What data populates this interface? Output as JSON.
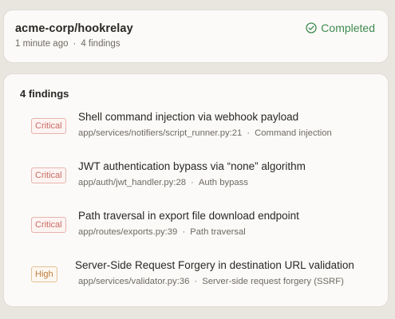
{
  "header": {
    "repo": "acme-corp/hookrelay",
    "time": "1 minute ago",
    "separator": "·",
    "findings_count": "4 findings",
    "status": "Completed",
    "status_icon": "check-circle-icon",
    "status_color": "#3e8a4f"
  },
  "findings_panel": {
    "title": "4 findings",
    "items": [
      {
        "severity": "Critical",
        "title": "Shell command injection via webhook payload",
        "location": "app/services/notifiers/script_runner.py:21",
        "category": "Command injection"
      },
      {
        "severity": "Critical",
        "title": "JWT authentication bypass via “none” algorithm",
        "location": "app/auth/jwt_handler.py:28",
        "category": "Auth bypass"
      },
      {
        "severity": "Critical",
        "title": "Path traversal in export file download endpoint",
        "location": "app/routes/exports.py:39",
        "category": "Path traversal"
      },
      {
        "severity": "High",
        "title": "Server-Side Request Forgery in destination URL validation",
        "location": "app/services/validator.py:36",
        "category": "Server-side request forgery (SSRF)"
      }
    ]
  }
}
